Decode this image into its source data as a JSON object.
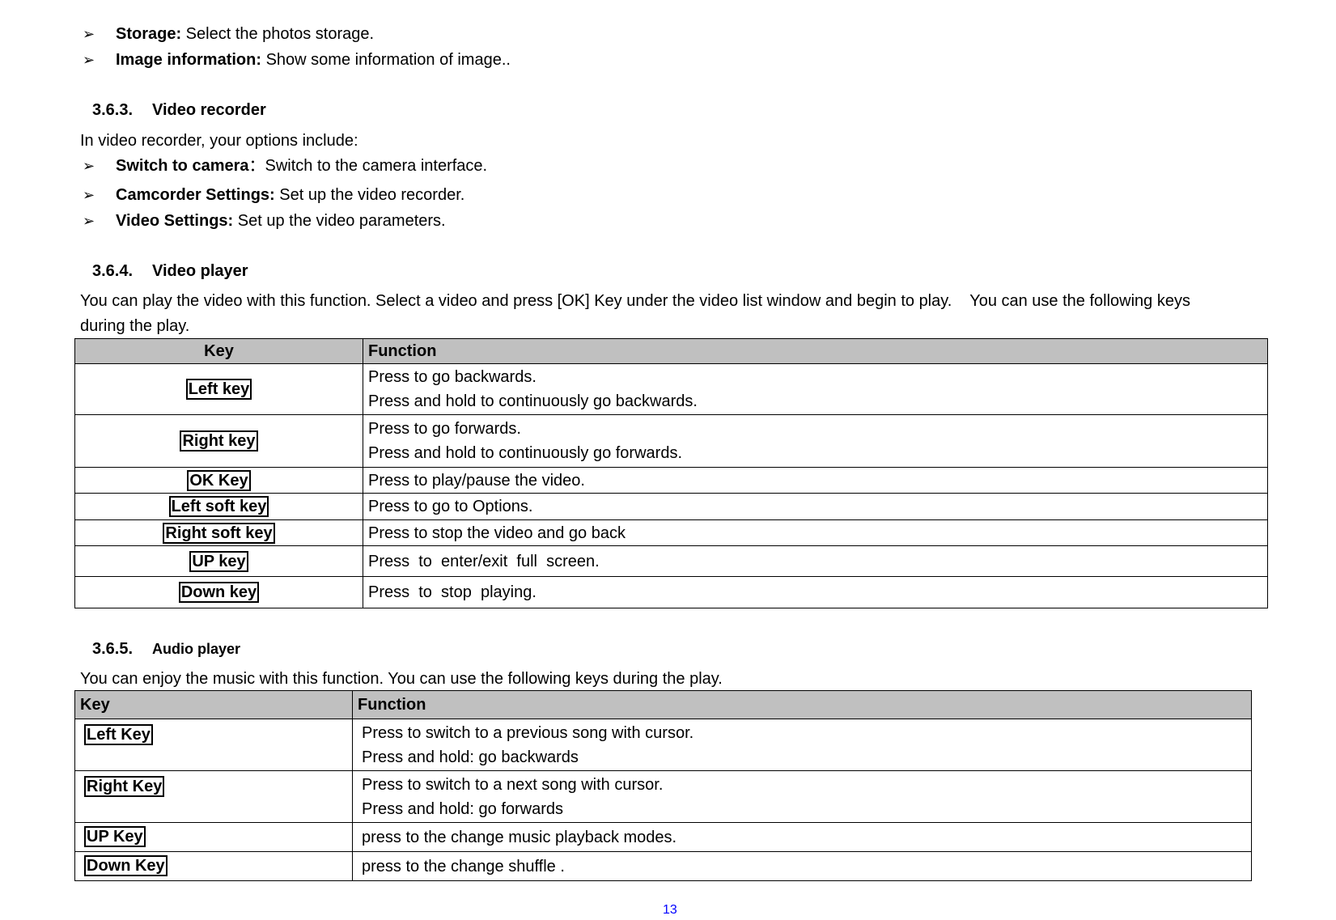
{
  "bullets_top": [
    {
      "term": "Storage:",
      "desc": " Select the photos storage."
    },
    {
      "term": "Image information:",
      "desc": " Show some information of image.."
    }
  ],
  "video_recorder": {
    "number": "3.6.3.",
    "title": "Video recorder",
    "intro": "In video recorder, your options include:",
    "bullets": [
      {
        "term": "Switch to camera",
        "desc": "：Switch to the camera interface."
      },
      {
        "term": "Camcorder Settings:",
        "desc": " Set up the video recorder."
      },
      {
        "term": "Video Settings:",
        "desc": " Set up the video parameters."
      }
    ]
  },
  "video_player": {
    "number": "3.6.4.",
    "title": "Video player",
    "para_line1": "You can play the video with this function. Select a video and press [OK] Key under the video list window and begin to play.    You can use the following keys",
    "para_line2": "during the play.",
    "table": {
      "headers": [
        "Key",
        "Function"
      ],
      "rows": [
        {
          "key": "Left key",
          "lines": [
            "Press to go backwards.",
            "Press and hold to continuously go backwards."
          ]
        },
        {
          "key": "Right key",
          "lines": [
            "Press to go forwards.",
            "Press and hold to continuously go forwards."
          ]
        },
        {
          "key": "OK Key",
          "lines": [
            "Press to play/pause the video."
          ]
        },
        {
          "key": "Left soft key",
          "lines": [
            "Press to go to Options."
          ]
        },
        {
          "key": "Right soft key",
          "lines": [
            "Press to stop the video and go back"
          ]
        },
        {
          "key": "UP key",
          "lines": [
            "Press  to  enter/exit  full  screen."
          ]
        },
        {
          "key": "Down key",
          "lines": [
            "Press  to  stop  playing."
          ]
        }
      ]
    }
  },
  "audio_player": {
    "number": "3.6.5.",
    "title": "Audio player",
    "intro": "You can enjoy the music with this function. You can use the following keys during the play.",
    "table": {
      "headers": [
        "Key",
        "Function"
      ],
      "rows": [
        {
          "key": "Left Key",
          "lines": [
            "Press to switch to a previous song with cursor.",
            "Press and hold: go backwards"
          ]
        },
        {
          "key": "Right Key",
          "lines": [
            "Press to switch to a next song with cursor.",
            "Press and hold: go forwards"
          ]
        },
        {
          "key": "UP Key",
          "lines": [
            "press to the change music playback modes."
          ]
        },
        {
          "key": "Down Key",
          "lines": [
            "press to the change shuffle ."
          ]
        }
      ]
    }
  },
  "page_number": "13",
  "colors": {
    "header_bg": "#c0c0c0",
    "page_number": "#0000ff"
  }
}
